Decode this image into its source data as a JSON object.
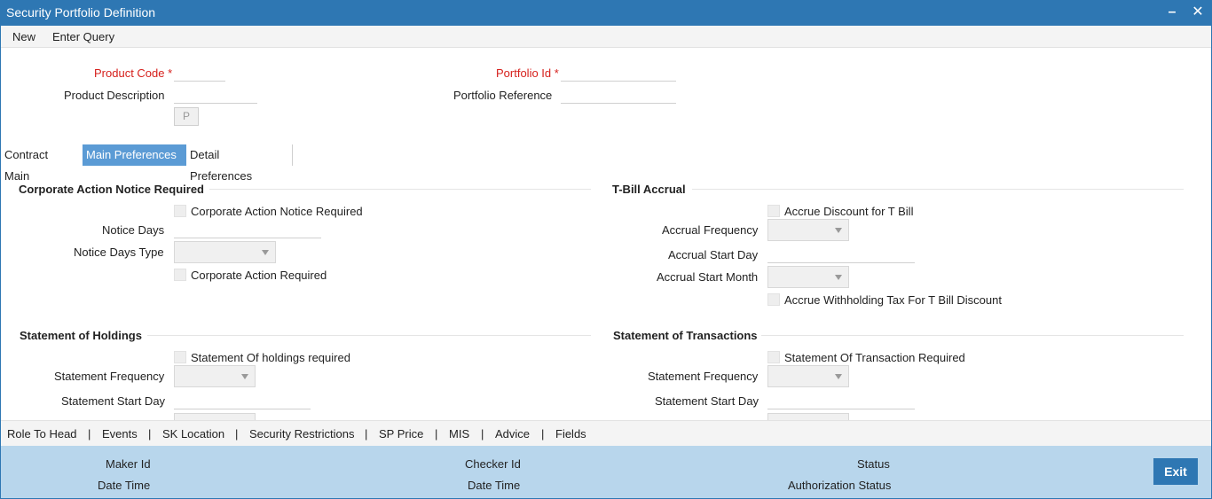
{
  "window": {
    "title": "Security Portfolio Definition",
    "minimize_icon": "minus-icon",
    "close_icon": "close-icon"
  },
  "toolbar": {
    "new_label": "New",
    "enter_query_label": "Enter Query"
  },
  "header_fields": {
    "product_code_label": "Product Code",
    "product_description_label": "Product Description",
    "p_button_label": "P",
    "portfolio_id_label": "Portfolio Id",
    "portfolio_reference_label": "Portfolio Reference",
    "required_marker": "*",
    "product_code_value": "",
    "product_description_value": "",
    "portfolio_id_value": "",
    "portfolio_reference_value": ""
  },
  "tabs": [
    {
      "label": "Contract Main"
    },
    {
      "label": "Main Preferences",
      "active": true
    },
    {
      "label": "Detail Preferences"
    }
  ],
  "corporate_action": {
    "heading": "Corporate Action Notice Required",
    "notice_required_checkbox": "Corporate Action Notice Required",
    "notice_days_label": "Notice Days",
    "notice_days_type_label": "Notice Days Type",
    "action_required_checkbox": "Corporate Action Required"
  },
  "tbill_accrual": {
    "heading": "T-Bill Accrual",
    "accrue_discount_checkbox": "Accrue Discount for T Bill",
    "accrual_frequency_label": "Accrual Frequency",
    "accrual_start_day_label": "Accrual Start Day",
    "accrual_start_month_label": "Accrual Start Month",
    "accrue_withholding_checkbox": "Accrue Withholding Tax For T Bill Discount"
  },
  "statement_holdings": {
    "heading": "Statement of Holdings",
    "required_checkbox": "Statement Of holdings required",
    "frequency_label": "Statement Frequency",
    "start_day_label": "Statement Start Day"
  },
  "statement_transactions": {
    "heading": "Statement of Transactions",
    "required_checkbox": "Statement Of Transaction Required",
    "frequency_label": "Statement Frequency",
    "start_day_label": "Statement Start Day"
  },
  "bottom_nav": {
    "items": [
      "Role To Head",
      "Events",
      "SK Location",
      "Security Restrictions",
      "SP Price",
      "MIS",
      "Advice",
      "Fields"
    ],
    "separator": "|"
  },
  "footer": {
    "maker_id_label": "Maker Id",
    "maker_date_time_label": "Date Time",
    "checker_id_label": "Checker Id",
    "checker_date_time_label": "Date Time",
    "status_label": "Status",
    "authorization_status_label": "Authorization Status",
    "exit_label": "Exit"
  },
  "colors": {
    "title_bar": "#2e77b3",
    "active_tab": "#5b9bd5",
    "required_label": "#d6201c",
    "footer_bg": "#b8d6ec"
  }
}
